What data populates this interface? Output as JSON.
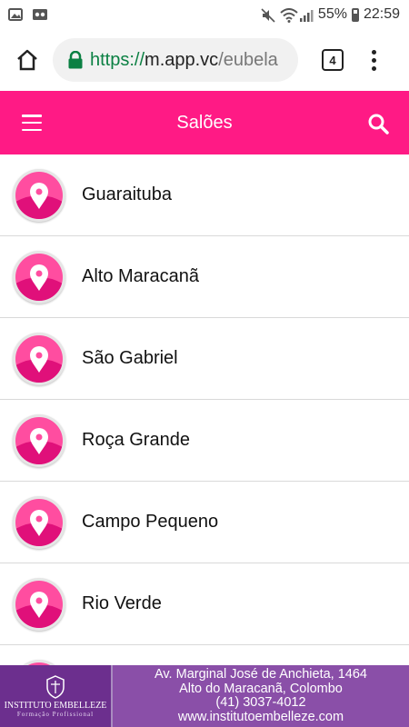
{
  "status_bar": {
    "battery": "55%",
    "time": "22:59"
  },
  "browser": {
    "url_scheme": "https://",
    "url_host": "m.app.vc",
    "url_path": "/eubela",
    "tab_count": "4"
  },
  "header": {
    "title": "Salões"
  },
  "colors": {
    "accent": "#ff1a85",
    "footer_bg": "#8a4fa8"
  },
  "list": {
    "items": [
      {
        "label": "Guaraituba"
      },
      {
        "label": "Alto Maracanã"
      },
      {
        "label": "São Gabriel"
      },
      {
        "label": "Roça Grande"
      },
      {
        "label": "Campo Pequeno"
      },
      {
        "label": "Rio Verde"
      },
      {
        "label": ""
      }
    ]
  },
  "footer": {
    "logo_name": "INSTITUTO EMBELLEZE",
    "logo_tagline": "Formação Profissional",
    "address_line1": "Av. Marginal José de Anchieta, 1464",
    "address_line2": "Alto do Maracanã, Colombo",
    "phone": "(41) 3037-4012",
    "website": "www.institutoembelleze.com"
  }
}
